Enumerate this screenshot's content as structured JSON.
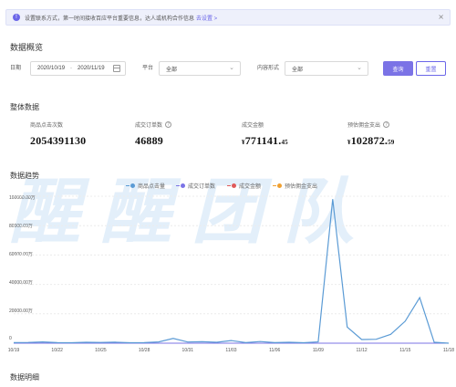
{
  "notice": {
    "text": "设置联系方式，第一时间接收百应平台重要信息，达人或机构合作信息",
    "link": "去设置 >",
    "close": "×"
  },
  "page_title": "数据概览",
  "filters": {
    "date_label": "日期",
    "date_start": "2020/10/19",
    "date_sep": "-",
    "date_end": "2020/11/19",
    "platform_label": "平台",
    "platform_value": "全部",
    "content_label": "内容形式",
    "content_value": "全部",
    "query_button": "查询",
    "reset_button": "重置"
  },
  "overall": {
    "title": "整体数据",
    "metrics": [
      {
        "label": "商品点击次数",
        "value": "2054391130",
        "currency": "",
        "decimal": ""
      },
      {
        "label": "成交订单数",
        "value": "46889",
        "currency": "",
        "decimal": ""
      },
      {
        "label": "成交金额",
        "value": "771141.",
        "currency": "¥",
        "decimal": "45"
      },
      {
        "label": "预估佣金支出",
        "value": "102872.",
        "currency": "¥",
        "decimal": "59"
      }
    ]
  },
  "watermark": "醒醒团队",
  "trend": {
    "title": "数据趋势",
    "legend": [
      "商品点击量",
      "成交订单数",
      "成交金额",
      "预估佣金支出"
    ],
    "colors": [
      "#5b9bd5",
      "#7b73e6",
      "#e05a5a",
      "#f0a030"
    ],
    "y_ticks": [
      "100000.00万",
      "80000.00万",
      "60000.00万",
      "40000.00万",
      "20000.00万",
      "0"
    ]
  },
  "detail": {
    "title": "数据明细"
  },
  "chart_data": {
    "type": "line",
    "x": [
      "10/19",
      "10/20",
      "10/21",
      "10/22",
      "10/23",
      "10/24",
      "10/25",
      "10/26",
      "10/27",
      "10/28",
      "10/29",
      "10/30",
      "10/31",
      "11/01",
      "11/02",
      "11/03",
      "11/04",
      "11/05",
      "11/06",
      "11/07",
      "11/08",
      "11/09",
      "11/10",
      "11/11",
      "11/12",
      "11/13",
      "11/14",
      "11/15",
      "11/16",
      "11/17",
      "11/18"
    ],
    "x_tick_labels": [
      "10/19",
      "10/22",
      "10/25",
      "10/28",
      "10/31",
      "11/03",
      "11/06",
      "11/09",
      "11/12",
      "11/15",
      "11/18"
    ],
    "ylim": [
      0,
      100000
    ],
    "y_unit": "万",
    "series": [
      {
        "name": "商品点击量",
        "values": [
          400,
          500,
          900,
          400,
          300,
          600,
          500,
          700,
          300,
          400,
          900,
          3200,
          800,
          1000,
          600,
          1800,
          400,
          1100,
          400,
          600,
          300,
          900,
          98000,
          11000,
          2500,
          2700,
          6000,
          15000,
          31000,
          600,
          0
        ]
      },
      {
        "name": "成交订单数",
        "values": [
          0,
          0,
          0,
          0,
          0,
          0,
          0,
          0,
          0,
          0,
          0,
          0,
          0,
          0,
          0,
          0,
          0,
          0,
          0,
          0,
          0,
          0,
          0,
          0,
          0,
          0,
          0,
          0,
          0,
          0,
          0
        ]
      },
      {
        "name": "成交金额",
        "values": [
          0,
          0,
          0,
          0,
          0,
          0,
          0,
          0,
          0,
          0,
          0,
          0,
          0,
          0,
          0,
          0,
          0,
          0,
          0,
          0,
          0,
          0,
          0,
          0,
          0,
          0,
          0,
          0,
          0,
          0,
          0
        ]
      },
      {
        "name": "预估佣金支出",
        "values": [
          0,
          0,
          0,
          0,
          0,
          0,
          0,
          0,
          0,
          0,
          0,
          0,
          0,
          0,
          0,
          0,
          0,
          0,
          0,
          0,
          0,
          0,
          0,
          0,
          0,
          0,
          0,
          0,
          0,
          0,
          0
        ]
      }
    ]
  }
}
